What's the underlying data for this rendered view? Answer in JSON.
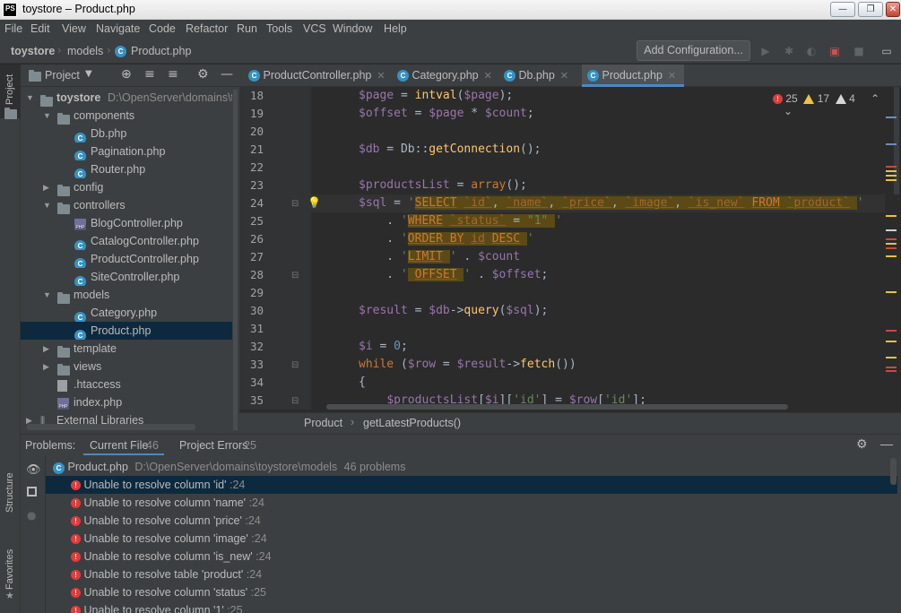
{
  "window": {
    "title": "toystore – Product.php",
    "logo_text": "PS",
    "min": "—",
    "max": "❐",
    "close": "✕"
  },
  "menu": [
    "File",
    "Edit",
    "View",
    "Navigate",
    "Code",
    "Refactor",
    "Run",
    "Tools",
    "VCS",
    "Window",
    "Help"
  ],
  "nav": {
    "project": "toystore",
    "folder": "models",
    "file": "Product.php",
    "add_config": "Add Configuration..."
  },
  "left_tabs": {
    "project": "Project",
    "structure": "Structure",
    "favorites": "Favorites"
  },
  "project_panel": {
    "title": "Project",
    "tree": [
      {
        "label": "toystore",
        "path": "D:\\OpenServer\\domains\\toystore",
        "icon": "folder",
        "level": 0,
        "open": true
      },
      {
        "label": "components",
        "icon": "folder",
        "level": 1,
        "open": true
      },
      {
        "label": "Db.php",
        "icon": "class",
        "level": 2
      },
      {
        "label": "Pagination.php",
        "icon": "class",
        "level": 2
      },
      {
        "label": "Router.php",
        "icon": "class",
        "level": 2
      },
      {
        "label": "config",
        "icon": "folder",
        "level": 1,
        "open": false
      },
      {
        "label": "controllers",
        "icon": "folder",
        "level": 1,
        "open": true
      },
      {
        "label": "BlogController.php",
        "icon": "php",
        "level": 2
      },
      {
        "label": "CatalogController.php",
        "icon": "class",
        "level": 2
      },
      {
        "label": "ProductController.php",
        "icon": "class",
        "level": 2
      },
      {
        "label": "SiteController.php",
        "icon": "class",
        "level": 2
      },
      {
        "label": "models",
        "icon": "folder",
        "level": 1,
        "open": true
      },
      {
        "label": "Category.php",
        "icon": "class",
        "level": 2
      },
      {
        "label": "Product.php",
        "icon": "class",
        "level": 2,
        "selected": true
      },
      {
        "label": "template",
        "icon": "folder",
        "level": 1,
        "open": false
      },
      {
        "label": "views",
        "icon": "folder",
        "level": 1,
        "open": false
      },
      {
        "label": ".htaccess",
        "icon": "file",
        "level": 1
      },
      {
        "label": "index.php",
        "icon": "php",
        "level": 1
      },
      {
        "label": "External Libraries",
        "icon": "lib",
        "level": 0,
        "open": false
      }
    ]
  },
  "editor_tabs": [
    {
      "label": "ProductController.php",
      "active": false
    },
    {
      "label": "Category.php",
      "active": false
    },
    {
      "label": "Db.php",
      "active": false
    },
    {
      "label": "Product.php",
      "active": true
    }
  ],
  "inspections": {
    "errors": "25",
    "warnings": "17",
    "weak_warnings": "4"
  },
  "code_lines": [
    "18",
    "19",
    "20",
    "21",
    "22",
    "23",
    "24",
    "25",
    "26",
    "27",
    "28",
    "29",
    "30",
    "31",
    "32",
    "33",
    "34",
    "35"
  ],
  "breadcrumb": {
    "class": "Product",
    "method": "getLatestProducts()"
  },
  "problems": {
    "label": "Problems:",
    "tab_current": "Current File",
    "tab_current_count": "46",
    "tab_project": "Project Errors",
    "tab_project_count": "25",
    "file": "Product.php",
    "file_path": "D:\\OpenServer\\domains\\toystore\\models",
    "file_count": "46 problems",
    "items": [
      {
        "text": "Unable to resolve column 'id'",
        "line": ":24",
        "selected": true
      },
      {
        "text": "Unable to resolve column 'name'",
        "line": ":24"
      },
      {
        "text": "Unable to resolve column 'price'",
        "line": ":24"
      },
      {
        "text": "Unable to resolve column 'image'",
        "line": ":24"
      },
      {
        "text": "Unable to resolve column 'is_new'",
        "line": ":24"
      },
      {
        "text": "Unable to resolve table 'product'",
        "line": ":24"
      },
      {
        "text": "Unable to resolve column 'status'",
        "line": ":25"
      },
      {
        "text": "Unable to resolve column '1'",
        "line": ":25"
      }
    ]
  }
}
